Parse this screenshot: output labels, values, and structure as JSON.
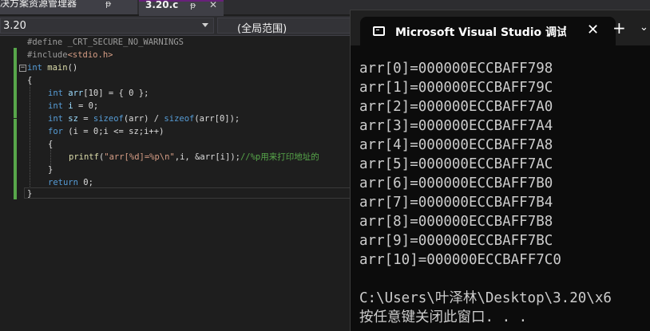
{
  "tabs": {
    "solution_explorer_label": "决方案资源管理器",
    "file_tab_label": "3.20.c",
    "pin_glyph": "ᵽ",
    "close_glyph": "✕"
  },
  "navbar": {
    "project_value": "3.20",
    "scope_value": "(全局范围)"
  },
  "code": {
    "line1": "#define _CRT_SECURE_NO_WARNINGS",
    "line2_a": "#include",
    "line2_b": "<stdio.h>",
    "line3_kw": "int",
    "line3_fn": " main",
    "line3_rest": "()",
    "line4": "{",
    "line5_kw": "int",
    "line5_var": " arr",
    "line5_rest": "[10] = { 0 };",
    "line6_kw": "int",
    "line6_var": " i",
    "line6_rest": " = 0;",
    "line7_kw": "int",
    "line7_var": " sz",
    "line7_mid1": " = ",
    "line7_kw2": "sizeof",
    "line7_mid2": "(arr) / ",
    "line7_kw3": "sizeof",
    "line7_rest": "(arr[0]);",
    "line8_kw": "for",
    "line8_rest": " (i = 0;i <= sz;i++)",
    "line9": "{",
    "line10_fn": "printf",
    "line10_open": "(",
    "line10_str": "\"arr[%d]=%p\\n\"",
    "line10_mid": ",i, &arr[i]);",
    "line10_cm": "//%p用来打印地址的",
    "line11": "}",
    "line12_kw": "return",
    "line12_rest": " 0;",
    "line13": "}"
  },
  "console": {
    "title": "Microsoft Visual Studio 调试控制台",
    "close_glyph": "✕",
    "plus_glyph": "+",
    "chevron_glyph": "⌄",
    "output_lines": [
      "arr[0]=000000ECCBAFF798",
      "arr[1]=000000ECCBAFF79C",
      "arr[2]=000000ECCBAFF7A0",
      "arr[3]=000000ECCBAFF7A4",
      "arr[4]=000000ECCBAFF7A8",
      "arr[5]=000000ECCBAFF7AC",
      "arr[6]=000000ECCBAFF7B0",
      "arr[7]=000000ECCBAFF7B4",
      "arr[8]=000000ECCBAFF7B8",
      "arr[9]=000000ECCBAFF7BC",
      "arr[10]=000000ECCBAFF7C0"
    ],
    "path_line": "C:\\Users\\叶泽林\\Desktop\\3.20\\x6",
    "press_key_line": "按任意键关闭此窗口. . ."
  },
  "colors": {
    "keyword": "#569cd6",
    "string": "#d69d85",
    "comment": "#57a64a",
    "change_bar": "#57a64a",
    "console_bg": "#0c0c0c"
  }
}
